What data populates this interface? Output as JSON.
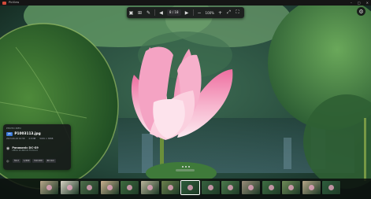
{
  "window": {
    "title": "PicView"
  },
  "toolbar": {
    "counter": "8 / 18",
    "zoom": "100%",
    "icons": [
      "image-view-icon",
      "gallery-icon",
      "edit-icon",
      "prev-icon",
      "next-icon",
      "zoom-out-icon",
      "zoom-in-icon",
      "fit-icon",
      "fullscreen-icon"
    ]
  },
  "info_panel": {
    "section_label": "PHOTO INFO",
    "file_badge": "JPG",
    "file_name": "P1003113.jpg",
    "date": "2023-06-18 10:58",
    "size": "4.8 MB",
    "dimensions": "5184 × 3888",
    "camera_name": "Panasonic DC-G9",
    "lens": "LEICA 12-60mm F2.8-4.0",
    "exif": [
      "f/4.0",
      "1/400",
      "ISO 200",
      "60 mm"
    ]
  },
  "filmstrip": {
    "count": 15,
    "active_index": 7,
    "thumb_colors": [
      "#b7a68a",
      "#d7d1c4",
      "#4f6e4b",
      "#c9b08f",
      "#3e6b3f",
      "#b9b39a",
      "#6b7f4d",
      "#2e5b3a",
      "#37623f",
      "#4c7a4c",
      "#9a8d7a",
      "#3f6e43",
      "#6f8a58",
      "#b4a588",
      "#2f5d3d"
    ]
  },
  "colors": {
    "accent": "#3a78d8",
    "petal": "#f28cb2"
  }
}
